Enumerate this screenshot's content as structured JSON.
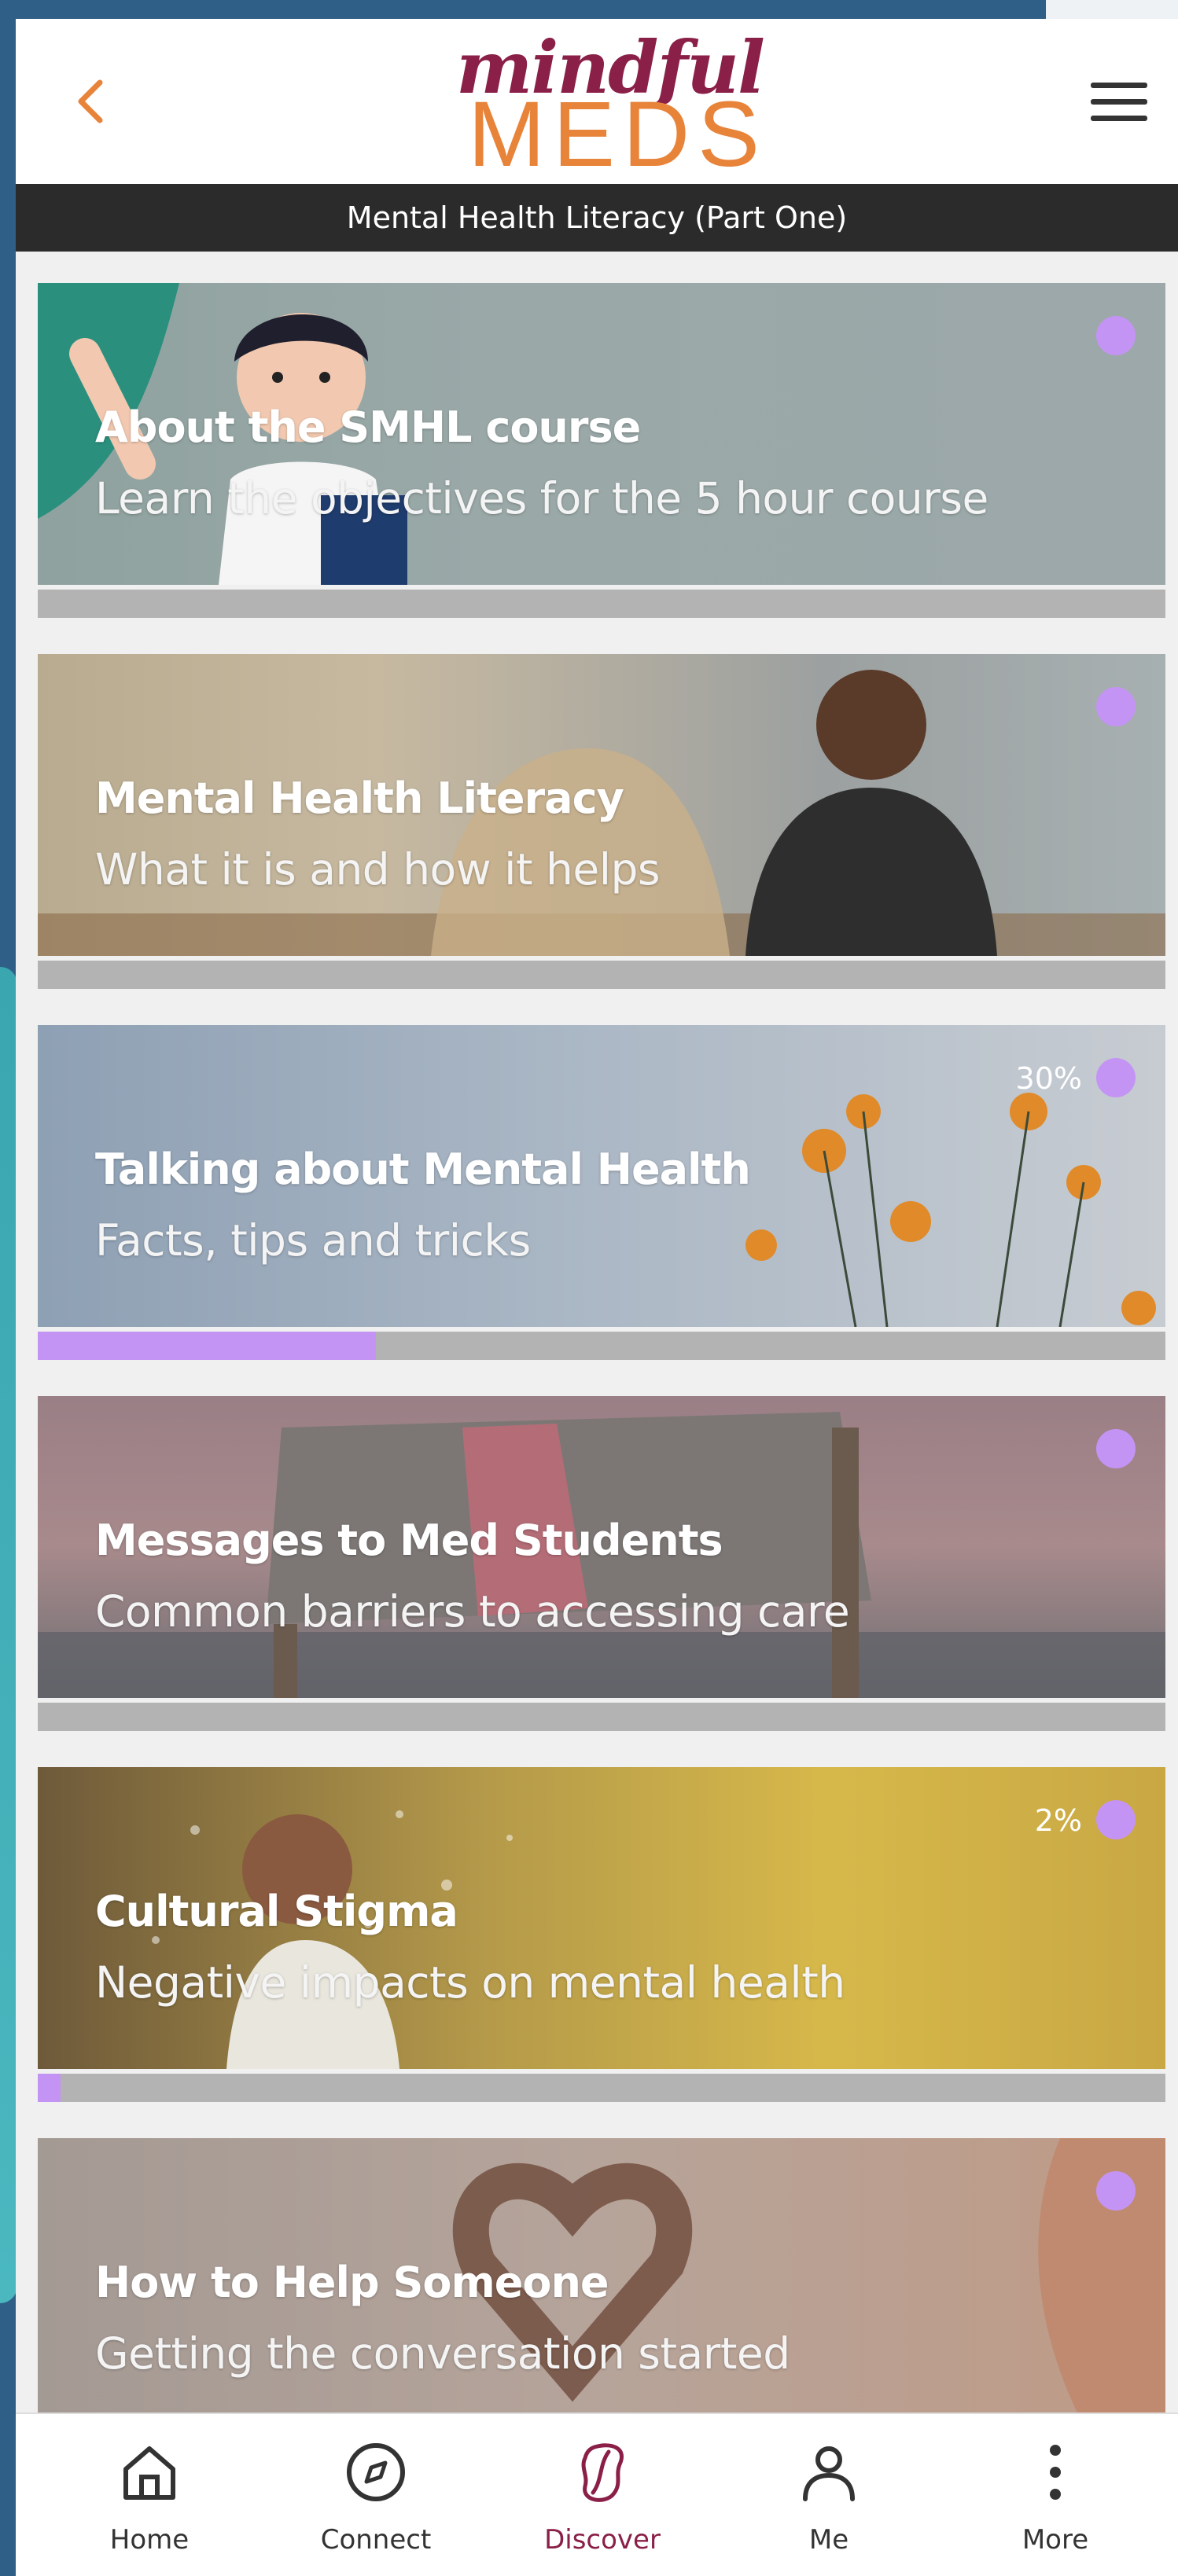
{
  "header": {
    "logo_script": "mindful",
    "logo_main": "MEDS",
    "back_icon": "chevron-left-icon",
    "menu_icon": "hamburger-menu-icon",
    "subtitle": "Mental Health Literacy (Part One)"
  },
  "colors": {
    "brand_maroon": "#8a1f48",
    "brand_orange": "#e8833a",
    "accent_purple": "#c494f4",
    "subbar": "#2b2b2b",
    "track_gray": "#b3b3b3"
  },
  "modules": [
    {
      "title": "About the SMHL course",
      "subtitle": "Learn the objectives for the 5 hour course",
      "progress_label": "",
      "progress": 0
    },
    {
      "title": "Mental Health Literacy",
      "subtitle": "What it is and how it helps",
      "progress_label": "",
      "progress": 0
    },
    {
      "title": "Talking about Mental Health",
      "subtitle": "Facts, tips and tricks",
      "progress_label": "30%",
      "progress": 30
    },
    {
      "title": "Messages to Med Students",
      "subtitle": "Common barriers to accessing care",
      "progress_label": "",
      "progress": 0
    },
    {
      "title": "Cultural Stigma",
      "subtitle": "Negative impacts on mental health",
      "progress_label": "2%",
      "progress": 2
    },
    {
      "title": "How to Help Someone",
      "subtitle": "Getting the conversation started",
      "progress_label": "",
      "progress": 0
    }
  ],
  "nav": {
    "items": [
      {
        "label": "Home",
        "icon": "home-icon"
      },
      {
        "label": "Connect",
        "icon": "compass-icon"
      },
      {
        "label": "Discover",
        "icon": "discover-icon"
      },
      {
        "label": "Me",
        "icon": "person-icon"
      },
      {
        "label": "More",
        "icon": "more-vertical-icon"
      }
    ],
    "active": "Discover"
  }
}
